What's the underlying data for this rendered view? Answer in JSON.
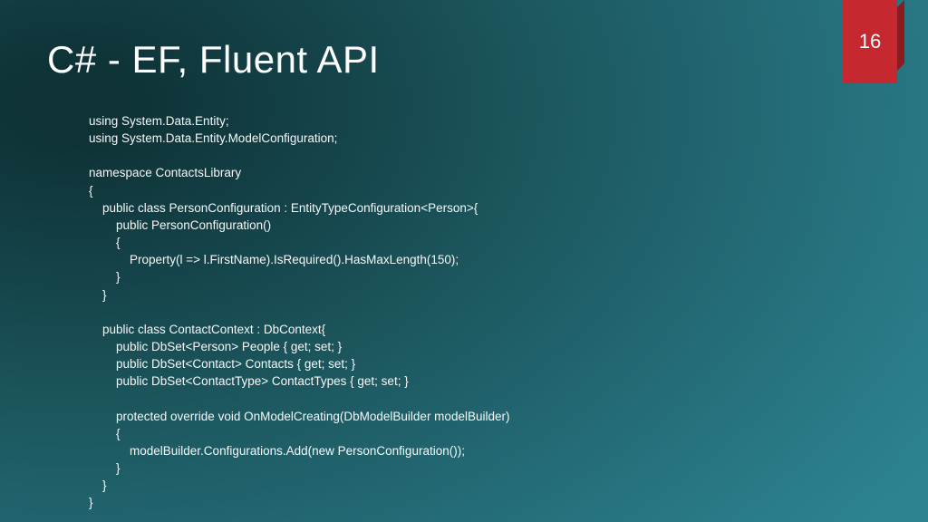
{
  "title": "C# - EF, Fluent API",
  "pageNumber": "16",
  "code": "using System.Data.Entity;\nusing System.Data.Entity.ModelConfiguration;\n\nnamespace ContactsLibrary\n{\n    public class PersonConfiguration : EntityTypeConfiguration<Person>{\n        public PersonConfiguration()\n        {\n            Property(l => l.FirstName).IsRequired().HasMaxLength(150);\n        }\n    }\n\n    public class ContactContext : DbContext{\n        public DbSet<Person> People { get; set; }\n        public DbSet<Contact> Contacts { get; set; }\n        public DbSet<ContactType> ContactTypes { get; set; }\n\n        protected override void OnModelCreating(DbModelBuilder modelBuilder)\n        {\n            modelBuilder.Configurations.Add(new PersonConfiguration());\n        }\n    }\n}"
}
